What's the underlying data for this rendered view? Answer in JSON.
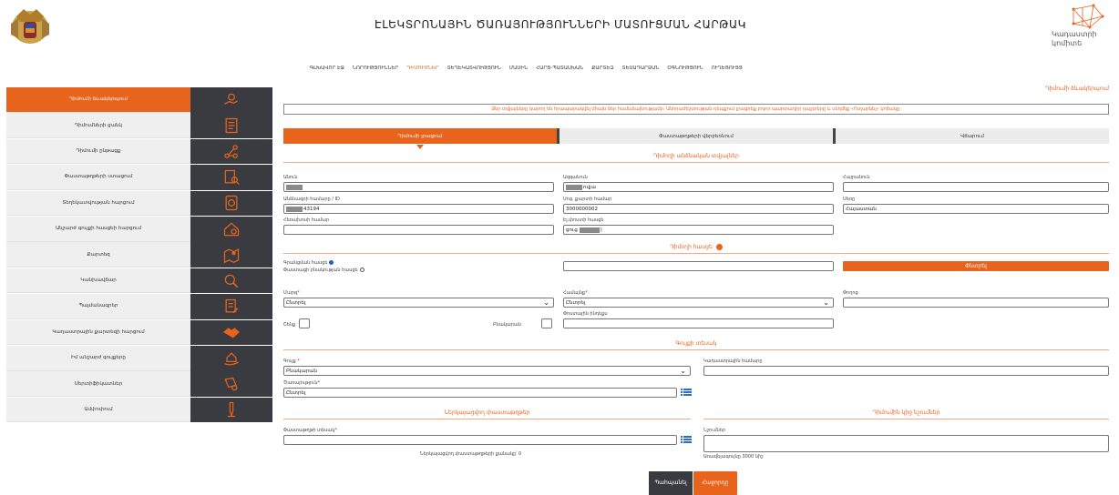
{
  "header": {
    "title": "ԷԼԵԿՏՐՈՆԱՅԻՆ ԾԱՌԱՅՈՒԹՅՈՒՆՆԵՐԻ ՄԱՏՈՒՑՄԱՆ ՀԱՐԹԱԿ",
    "brand_line1": "Կադաստրի",
    "brand_line2": "կոմիտե"
  },
  "topnav": [
    "ԳԼԽԱՎՈՐ ԷՋ",
    "ՆՈՐՈՒԹՅՈՒՆՆԵՐ",
    "ԴԻՄՈՒՄՆԵՐ",
    "ՏԵՂԵԿԱՏՎՈՒԹՅՈՒՆ",
    "ՄԱՍԻՆ",
    "ՀԱՐՑ-ՊԱՏԱՍԽԱՆ",
    "ՔԱՐՏԵԶ",
    "ՏԵՍԱԴԱՐՁԱՆ",
    "ՕԳՆՈՒԹՅՈՒՆ",
    "ՈՒՂԵՑՈՒՅՑ"
  ],
  "sidebar": [
    {
      "label": "Դիմումի ձևակերպում",
      "icon": "hand-coin-icon"
    },
    {
      "label": "Դիմումների ցանկ",
      "icon": "document-list-icon"
    },
    {
      "label": "Դիմումի ընթացք",
      "icon": "flow-icon"
    },
    {
      "label": "Փաստաթղթերի ստացում",
      "icon": "document-search-icon"
    },
    {
      "label": "Տեղեկատվության հարցում",
      "icon": "money-doc-icon"
    },
    {
      "label": "Անշարժ գույքի հասցեի հարցում",
      "icon": "house-search-icon"
    },
    {
      "label": "Քարտեզ",
      "icon": "map-pin-icon"
    },
    {
      "label": "Կանխավճար",
      "icon": "search-coin-icon"
    },
    {
      "label": "Պայմանագրեր",
      "icon": "contract-icon"
    },
    {
      "label": "Կադաստրային քարտեզի հարցում",
      "icon": "handshake-icon"
    },
    {
      "label": "Իմ անշարժ գույքերը",
      "icon": "home-hand-icon"
    },
    {
      "label": "Սերտիֆիկատներ",
      "icon": "certificate-icon"
    },
    {
      "label": "Ամփոփում",
      "icon": "pen-icon"
    }
  ],
  "page": {
    "crumb": "Դիմումի ձևակերպում",
    "notice": "Ձեր տվյալները կարող են հրապարակվել միայն ձեր համաձայնությամբ։ Անհրաժեշտության դեպքում լրացրեք բոլոր պարտադիր դաշտերը և սեղմեք «Ուղարկել» կոճակը։"
  },
  "tabs": [
    "Դիմումի լրացում",
    "Փաստաթղթերի վերբեռնում",
    "Վճարում"
  ],
  "applicant": {
    "section_title": "Դիմողի անձնական տվյալներ",
    "first_name_label": "Անուն",
    "first_name_value": "",
    "last_name_label": "Ազգանուն",
    "last_name_value": "ովյա",
    "patronymic_label": "Հայրանուն",
    "passport_label": "Անձնագրի համարը / ID",
    "passport_value": "43194",
    "ssn_label": "Սոց. քարտի համար",
    "ssn_value": "3000000002",
    "gender_label": "Սեռը",
    "gender_value": "Հայաստան",
    "phone_label": "Հեռախոսի համար",
    "email_label": "Էլ.փոստի հասցե",
    "email_value": "ցուց",
    "email_value_suffix": ")"
  },
  "address": {
    "section_title": "Դիմողի հասցե",
    "registered_label": "Գրանցման հասցե",
    "actual_label": "Փաստացի բնակության հասցե",
    "search_button": "Փնտրել",
    "region_label": "Մարզ",
    "region_value": "Ընտրել",
    "community_label": "Համայնք",
    "community_value": "Ընտրել",
    "street_label": "Փողոց",
    "building_label": "Շենք",
    "apartment_label": "Բնակարան",
    "zip_label": "Փոստային ինդեքս"
  },
  "property": {
    "section_title": "Գույքի տեսակ",
    "type_label": "Գույք",
    "type_value": "Բնակարան",
    "cadastral_label": "Կադաստրային համարը",
    "service_label": "Ծառայություն",
    "service_value": "Ընտրել"
  },
  "documents": {
    "section_title": "Ներկայացվող փաստաթղթեր",
    "doc_type_label": "Փաստաթղթի տեսակ",
    "count_text": "Ներկայացվող փաստաթղթերի քանակը՝ 0"
  },
  "notes": {
    "section_title": "Դիմումին կից նշումներ",
    "note_label": "Նշումներ",
    "limit_text": "Առավելագույնը 3000 նիշ"
  },
  "actions": {
    "save": "Պահպանել",
    "next": "Հաջորդը"
  },
  "colors": {
    "accent": "#e8631c",
    "dark": "#3a3b40"
  }
}
